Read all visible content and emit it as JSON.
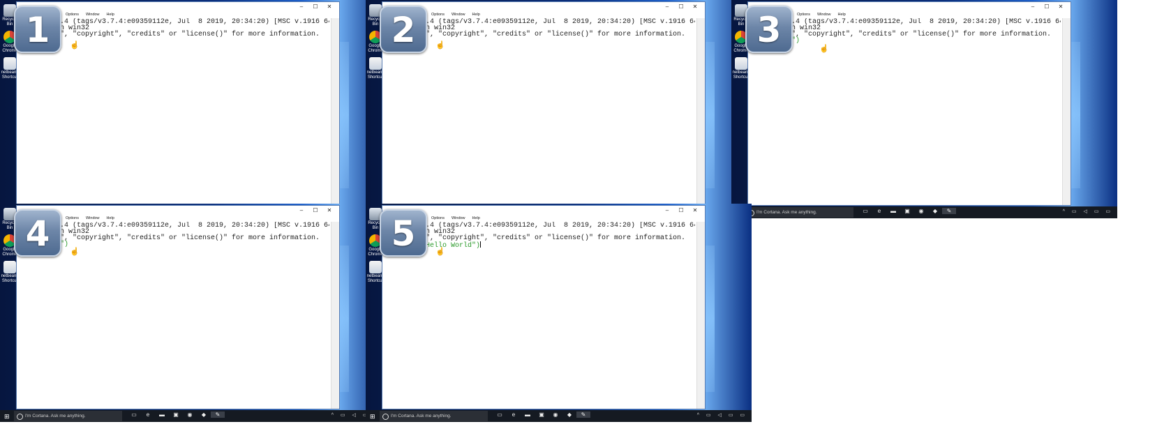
{
  "panels": [
    {
      "step": "1",
      "prompt_text": ""
    },
    {
      "step": "2",
      "prompt_text": ""
    },
    {
      "step": "3",
      "prompt_text": "\"\")"
    },
    {
      "step": "4",
      "prompt_text": "\"\")"
    },
    {
      "step": "5",
      "prompt_text": "\"Hello World\")"
    }
  ],
  "window": {
    "menus": [
      "Options",
      "Window",
      "Help"
    ],
    "minimize_icon": "–",
    "maximize_icon": "☐",
    "close_icon": "✕",
    "line1": ".4 (tags/v3.7.4:e09359112e, Jul  8 2019, 20:34:20) [MSC v.1916 64 bit",
    "line2": "n win32",
    "line3": "\", \"copyright\", \"credits\" or \"license()\" for more information."
  },
  "desktop": {
    "icons": [
      "Recycle Bin",
      "Google Chrome",
      "netbeans Shortcut"
    ]
  },
  "taskbar": {
    "start_glyph": "⊞",
    "cortana_placeholder": "I'm Cortana. Ask me anything.",
    "icons": [
      "task-view",
      "edge",
      "file-explorer",
      "store",
      "chrome",
      "netbeans",
      "idle"
    ],
    "icon_glyphs": [
      "▭",
      "e",
      "▬",
      "▣",
      "◉",
      "◆",
      "✎"
    ],
    "tray": "^ ▭ ◁ ▭ ▭"
  },
  "colors": {
    "prompt_green": "#2a9a2a",
    "badge": "#6d86a8"
  }
}
